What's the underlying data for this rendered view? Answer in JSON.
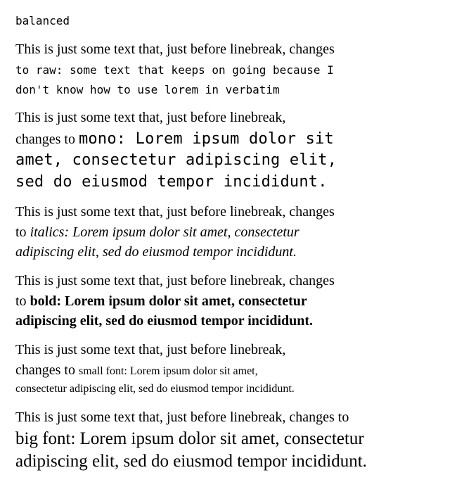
{
  "heading": "balanced",
  "blocks": [
    {
      "id": "raw",
      "lines": [
        [
          "This is just some text that, just before linebreak, changes"
        ],
        [
          "to raw: some text that keeps on going because I"
        ],
        [
          "don't know how to use lorem in verbatim"
        ]
      ]
    },
    {
      "id": "mono",
      "lines": [
        [
          "This is just some text that, just before linebreak,"
        ],
        [
          "changes to ",
          "mono: Lorem ipsum dolor sit"
        ],
        [
          "amet, consectetur adipiscing elit,"
        ],
        [
          "sed do eiusmod tempor incididunt."
        ]
      ]
    },
    {
      "id": "italics",
      "lines": [
        [
          "This is just some text that, just before linebreak, changes"
        ],
        [
          "to ",
          "italics: Lorem ipsum dolor sit amet, consectetur"
        ],
        [
          "adipiscing elit, sed do eiusmod tempor incididunt."
        ]
      ]
    },
    {
      "id": "bold",
      "lines": [
        [
          "This is just some text that, just before linebreak, changes"
        ],
        [
          "to ",
          "bold: Lorem ipsum dolor sit amet, consectetur"
        ],
        [
          "adipiscing elit, sed do eiusmod tempor incididunt."
        ]
      ]
    },
    {
      "id": "small",
      "lines": [
        [
          "This is just some text that, just before linebreak,"
        ],
        [
          "changes to ",
          "small font: Lorem ipsum dolor sit amet,"
        ],
        [
          "consectetur adipiscing elit, sed do eiusmod tempor incididunt."
        ]
      ]
    },
    {
      "id": "big",
      "lines": [
        [
          "This is just some text that, just before linebreak, changes to"
        ],
        [
          "big font: Lorem ipsum dolor sit amet, consectetur"
        ],
        [
          "adipiscing elit, sed do eiusmod tempor incididunt."
        ]
      ]
    }
  ]
}
